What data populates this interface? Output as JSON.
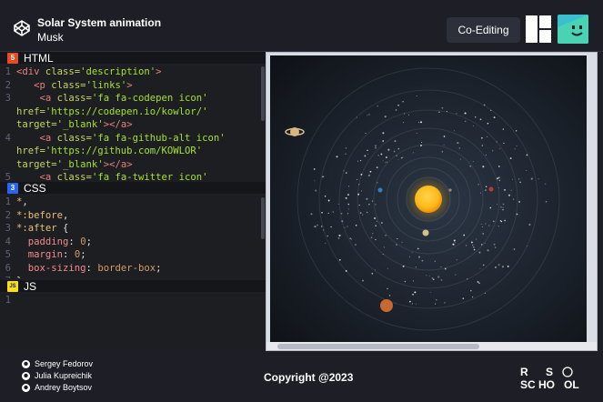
{
  "header": {
    "title": "Solar System animation",
    "subtitle": "Musk",
    "coedit_label": "Co-Editing"
  },
  "editors": {
    "html": {
      "label": "HTML",
      "badge": "5",
      "lines": [
        {
          "n": "1",
          "segs": [
            [
              "tag",
              "<div "
            ],
            [
              "attr",
              "class="
            ],
            [
              "str",
              "'description'"
            ],
            [
              "tag",
              ">"
            ]
          ]
        },
        {
          "n": "2",
          "segs": [
            [
              "plain",
              "   "
            ],
            [
              "tag",
              "<p "
            ],
            [
              "attr",
              "class="
            ],
            [
              "str",
              "'links'"
            ],
            [
              "tag",
              ">"
            ]
          ]
        },
        {
          "n": "3",
          "segs": [
            [
              "plain",
              "    "
            ],
            [
              "tag",
              "<a "
            ],
            [
              "attr",
              "class="
            ],
            [
              "str",
              "'fa fa-codepen icon'"
            ]
          ]
        },
        {
          "n": "",
          "segs": [
            [
              "attr",
              "href="
            ],
            [
              "str",
              "'https://codepen.io/kowlor/'"
            ]
          ]
        },
        {
          "n": "",
          "segs": [
            [
              "attr",
              "target="
            ],
            [
              "str",
              "'_blank'"
            ],
            [
              "tag",
              "></a>"
            ]
          ]
        },
        {
          "n": "4",
          "segs": [
            [
              "plain",
              "    "
            ],
            [
              "tag",
              "<a "
            ],
            [
              "attr",
              "class="
            ],
            [
              "str",
              "'fa fa-github-alt icon'"
            ]
          ]
        },
        {
          "n": "",
          "segs": [
            [
              "attr",
              "href="
            ],
            [
              "str",
              "'https://github.com/KOWLOR'"
            ]
          ]
        },
        {
          "n": "",
          "segs": [
            [
              "attr",
              "target="
            ],
            [
              "str",
              "'_blank'"
            ],
            [
              "tag",
              "></a>"
            ]
          ]
        },
        {
          "n": "5",
          "segs": [
            [
              "plain",
              "    "
            ],
            [
              "tag",
              "<a "
            ],
            [
              "attr",
              "class="
            ],
            [
              "str",
              "'fa fa-twitter icon'"
            ]
          ]
        }
      ]
    },
    "css": {
      "label": "CSS",
      "badge": "3",
      "lines": [
        {
          "n": "1",
          "segs": [
            [
              "sel",
              "*"
            ],
            [
              "plain",
              ","
            ]
          ]
        },
        {
          "n": "2",
          "segs": [
            [
              "sel",
              "*:before"
            ],
            [
              "plain",
              ","
            ]
          ]
        },
        {
          "n": "3",
          "segs": [
            [
              "sel",
              "*:after"
            ],
            [
              "plain",
              " {"
            ]
          ]
        },
        {
          "n": "4",
          "segs": [
            [
              "plain",
              "  "
            ],
            [
              "prop",
              "padding"
            ],
            [
              "plain",
              ": "
            ],
            [
              "num",
              "0"
            ],
            [
              "plain",
              ";"
            ]
          ]
        },
        {
          "n": "5",
          "segs": [
            [
              "plain",
              "  "
            ],
            [
              "prop",
              "margin"
            ],
            [
              "plain",
              ": "
            ],
            [
              "num",
              "0"
            ],
            [
              "plain",
              ";"
            ]
          ]
        },
        {
          "n": "6",
          "segs": [
            [
              "plain",
              "  "
            ],
            [
              "prop",
              "box-sizing"
            ],
            [
              "plain",
              ": "
            ],
            [
              "num",
              "border-box"
            ],
            [
              "plain",
              ";"
            ]
          ]
        },
        {
          "n": "7",
          "segs": [
            [
              "plain",
              "}"
            ]
          ]
        }
      ]
    },
    "js": {
      "label": "JS",
      "badge": "JS",
      "lines": [
        {
          "n": "1",
          "segs": []
        }
      ]
    }
  },
  "footer": {
    "authors": [
      "Sergey Fedorov",
      "Julia Kupreichik",
      "Andrey Boytsov"
    ],
    "copyright": "Copyright @2023",
    "school_logo_text": "RS SCHOOL"
  },
  "colors": {
    "html_badge": "#e34c26",
    "css_badge": "#2965f1",
    "js_badge": "#f7df1e",
    "sun": "#fbb917",
    "avatar": "#3bbfd0"
  },
  "icons": [
    "codepen-icon",
    "layout-icon",
    "avatar-icon",
    "github-icon",
    "rs-school-logo"
  ]
}
